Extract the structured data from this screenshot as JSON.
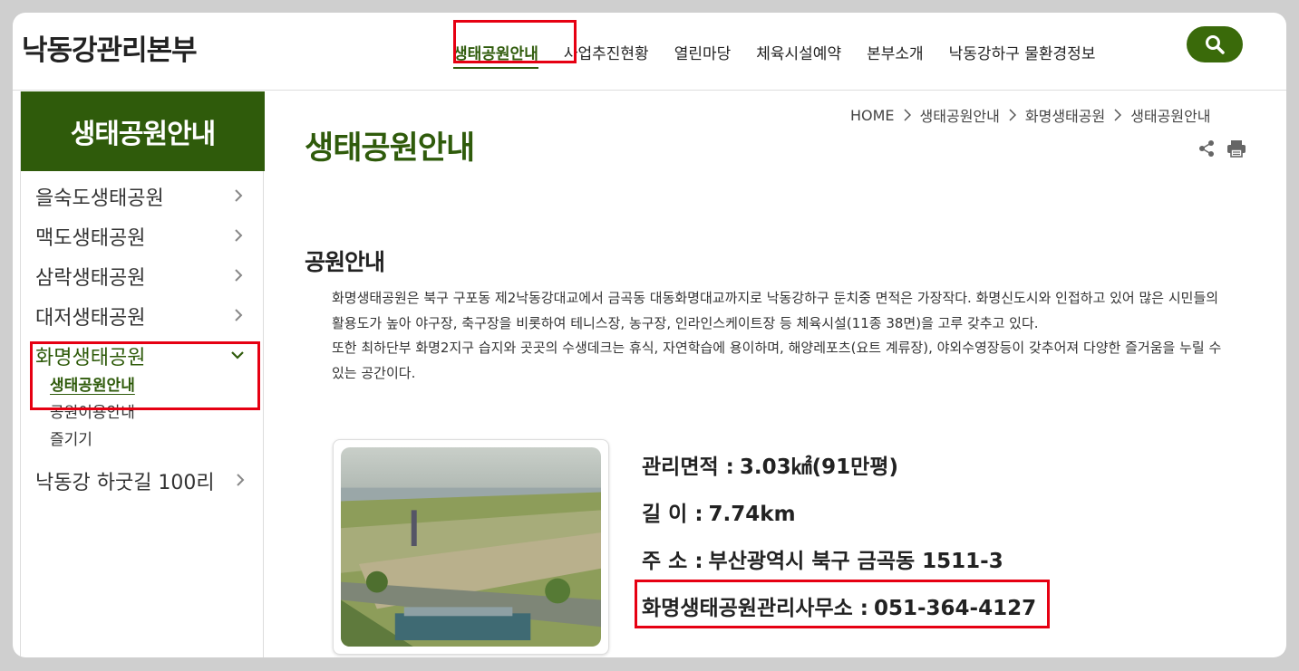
{
  "header": {
    "logo": "낙동강관리본부",
    "nav": [
      {
        "label": "생태공원안내"
      },
      {
        "label": "사업추진현황"
      },
      {
        "label": "열린마당"
      },
      {
        "label": "체육시설예약"
      },
      {
        "label": "본부소개"
      },
      {
        "label": "낙동강하구 물환경정보"
      }
    ],
    "search_icon": "search-icon",
    "accent_color": "#2f5b0b"
  },
  "sidebar": {
    "title": "생태공원안내",
    "items": [
      {
        "label": "을숙도생태공원"
      },
      {
        "label": "맥도생태공원"
      },
      {
        "label": "삼락생태공원"
      },
      {
        "label": "대저생태공원"
      },
      {
        "label": "화명생태공원"
      },
      {
        "label": "낙동강 하굿길 100리"
      }
    ],
    "subitems": [
      {
        "label": "생태공원안내"
      },
      {
        "label": "공원이용안내"
      },
      {
        "label": "즐기기"
      }
    ]
  },
  "breadcrumb": [
    "HOME",
    "생태공원안내",
    "화명생태공원",
    "생태공원안내"
  ],
  "main": {
    "title": "생태공원안내",
    "section_title": "공원안내",
    "desc_line1": "화명생태공원은 북구 구포동 제2낙동강대교에서 금곡동 대동화명대교까지로 낙동강하구 둔치중 면적은 가장작다. 화명신도시와 인접하고 있어 많은 시민들의 활용도가 높아 야구장, 축구장을 비롯하여 테니스장, 농구장, 인라인스케이트장 등 체육시설(11종 38면)을 고루 갖추고 있다.",
    "desc_line2": "또한 최하단부 화명2지구 습지와 곳곳의 수생데크는 휴식, 자연학습에 용이하며, 해양레포츠(요트 계류장), 야외수영장등이 갖추어져 다양한 즐거움을 누릴 수 있는 공간이다.",
    "info": {
      "area_label": "관리면적 :",
      "area_value": "3.03㎢(91만평)",
      "length_label": "길 이 :",
      "length_value": "7.74km",
      "address_label": "주 소 :",
      "address_value": "부산광역시 북구 금곡동 1511-3",
      "office_label": "화명생태공원관리사무소 :",
      "office_value": "051-364-4127"
    }
  }
}
